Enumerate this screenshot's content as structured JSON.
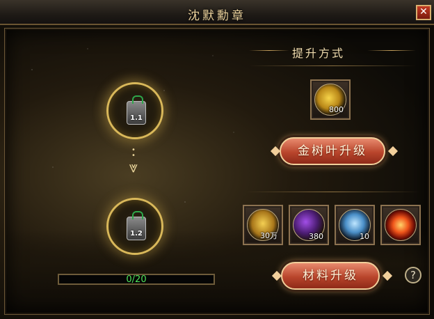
{
  "window": {
    "title": "沈默勳章",
    "close_glyph": "✕"
  },
  "left": {
    "medal_current": {
      "level": "1.1"
    },
    "medal_next": {
      "level": "1.2"
    },
    "progress": {
      "text": "0/20",
      "current": 0,
      "max": 20
    }
  },
  "right": {
    "section_title": "提升方式",
    "gold_leaf_cost": {
      "count": "800",
      "icon": "gold-leaf-icon"
    },
    "gold_leaf_button": "金树叶升级",
    "materials": [
      {
        "icon": "gold-ingot-icon",
        "count": "30万"
      },
      {
        "icon": "purple-crystal-icon",
        "count": "380"
      },
      {
        "icon": "blue-crystal-icon",
        "count": "10"
      },
      {
        "icon": "fire-orb-icon",
        "count": ""
      }
    ],
    "material_button": "材料升级",
    "help_glyph": "?"
  },
  "colors": {
    "accent_gold": "#d9b85a",
    "button_red": "#b9452c",
    "progress_text": "#4fe35a"
  }
}
